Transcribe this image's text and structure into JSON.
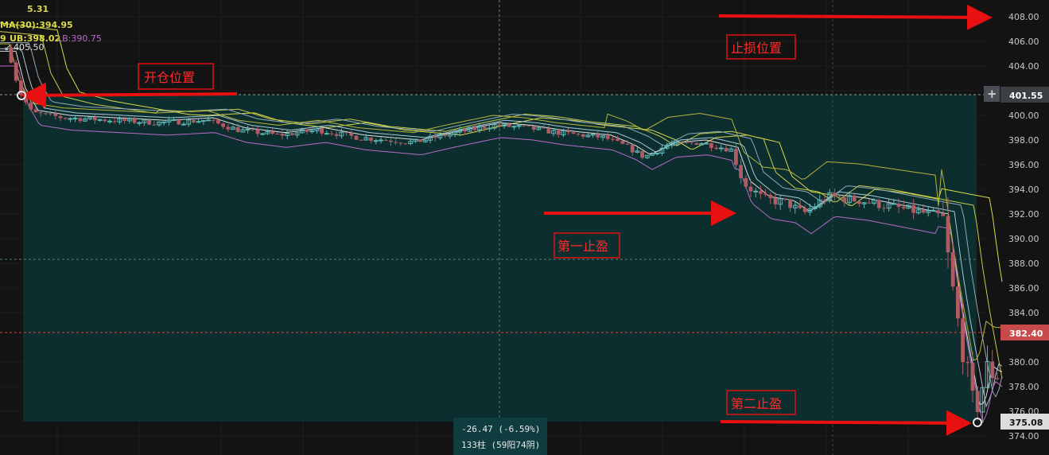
{
  "indicators": {
    "line1": "5.31",
    "ma30": "MA(30):394.95",
    "boll_prefix": "9",
    "ub": "UB:398.02",
    "lb": "LB:390.75",
    "last_price": "405.50"
  },
  "y_axis": {
    "ticks": [
      "408.00",
      "406.00",
      "404.00",
      "402.00",
      "400.00",
      "398.00",
      "396.00",
      "394.00",
      "392.00",
      "390.00",
      "388.00",
      "386.00",
      "384.00",
      "382.00",
      "380.00",
      "378.00",
      "376.00",
      "374.00"
    ],
    "tags": {
      "entry": "401.55",
      "current": "382.40",
      "low": "375.08"
    },
    "plus_symbol": "+"
  },
  "annotations": {
    "entry": "开仓位置",
    "stop_loss": "止损位置",
    "tp1": "第一止盈",
    "tp2": "第二止盈"
  },
  "measure": {
    "change": "-26.47 (-6.59%)",
    "bars": "133柱 (59阳74阴)"
  },
  "colors": {
    "up": "#63b6b6",
    "down": "#b05a63",
    "zone": "#0d2e2f",
    "arrow": "#e81010",
    "tag_red": "#c94a4a",
    "ma_yellow": "#d9d94a",
    "lb_purple": "#b56bc3"
  },
  "chart_data": {
    "type": "candlestick",
    "y_range": [
      374,
      408
    ],
    "entry_price": 401.55,
    "low_price": 375.08,
    "current_price": 382.4
  }
}
